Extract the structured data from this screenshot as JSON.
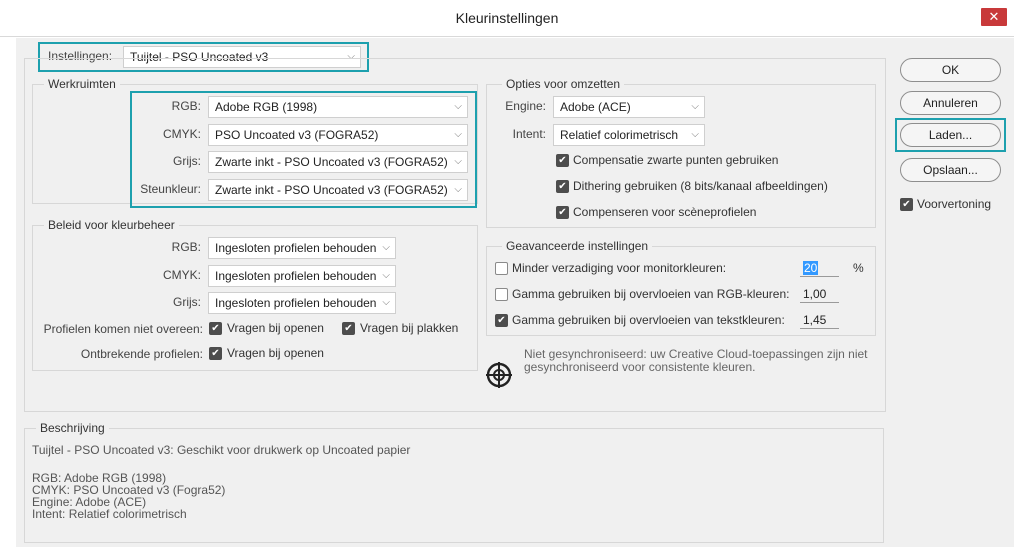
{
  "window": {
    "title": "Kleurinstellingen",
    "close_glyph": "✕"
  },
  "settings": {
    "label": "Instellingen:",
    "value": "Tuijtel - PSO Uncoated v3"
  },
  "workspaces": {
    "title": "Werkruimten",
    "rows": [
      {
        "label": "RGB:",
        "value": "Adobe RGB (1998)"
      },
      {
        "label": "CMYK:",
        "value": "PSO Uncoated v3 (FOGRA52)"
      },
      {
        "label": "Grijs:",
        "value": "Zwarte inkt - PSO Uncoated v3 (FOGRA52)"
      },
      {
        "label": "Steunkleur:",
        "value": "Zwarte inkt - PSO Uncoated v3 (FOGRA52)"
      }
    ]
  },
  "policies": {
    "title": "Beleid voor kleurbeheer",
    "rows": [
      {
        "label": "RGB:",
        "value": "Ingesloten profielen behouden"
      },
      {
        "label": "CMYK:",
        "value": "Ingesloten profielen behouden"
      },
      {
        "label": "Grijs:",
        "value": "Ingesloten profielen behouden"
      }
    ],
    "mismatch_label": "Profielen komen niet overeen:",
    "ask_open": "Vragen bij openen",
    "ask_paste": "Vragen bij plakken",
    "missing_label": "Ontbrekende profielen:",
    "missing_ask_open": "Vragen bij openen"
  },
  "conversion": {
    "title": "Opties voor omzetten",
    "engine_label": "Engine:",
    "engine_value": "Adobe (ACE)",
    "intent_label": "Intent:",
    "intent_value": "Relatief colorimetrisch",
    "blackpoint": "Compensatie zwarte punten gebruiken",
    "dither": "Dithering gebruiken (8 bits/kanaal afbeeldingen)",
    "scene": "Compenseren voor scèneprofielen"
  },
  "advanced": {
    "title": "Geavanceerde instellingen",
    "desaturate_label": "Minder verzadiging voor monitorkleuren:",
    "desaturate_value": "20",
    "desaturate_unit": "%",
    "blend_rgb_label": "Gamma gebruiken bij overvloeien van RGB-kleuren:",
    "blend_rgb_value": "1,00",
    "blend_text_label": "Gamma gebruiken bij overvloeien van tekstkleuren:",
    "blend_text_value": "1,45"
  },
  "sync": {
    "line1": "Niet gesynchroniseerd: uw Creative Cloud-toepassingen zijn niet",
    "line2": "gesynchroniseerd voor consistente kleuren."
  },
  "description": {
    "title": "Beschrijving",
    "lines": [
      "Tuijtel - PSO Uncoated v3:  Geschikt voor drukwerk op Uncoated papier",
      "",
      "RGB: Adobe RGB (1998)",
      "CMYK: PSO Uncoated v3 (Fogra52)",
      "Engine: Adobe (ACE)",
      "Intent: Relatief colorimetrisch"
    ]
  },
  "buttons": {
    "ok": "OK",
    "cancel": "Annuleren",
    "load": "Laden...",
    "save": "Opslaan...",
    "preview": "Voorvertoning"
  },
  "icons": {
    "checkmark": "✔",
    "chevron": "⌵",
    "sync_icon": "crosshair-target-icon"
  },
  "colors": {
    "highlight": "#1da0ae",
    "close": "#c8393a",
    "selection": "#3399ff"
  }
}
